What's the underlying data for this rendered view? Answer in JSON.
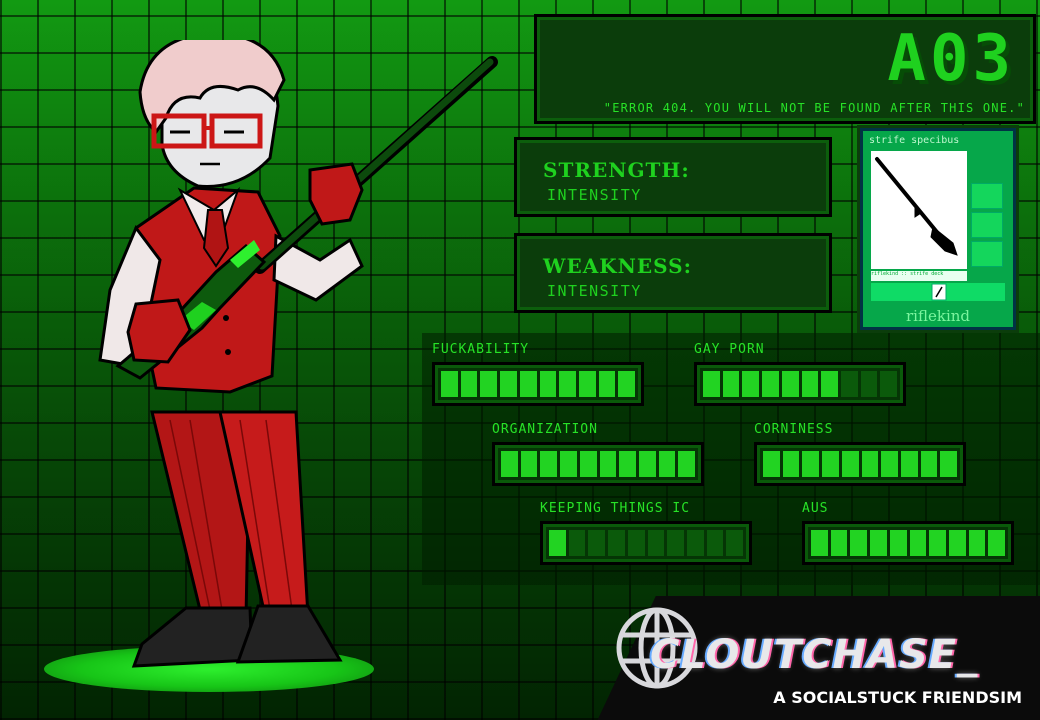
{
  "header": {
    "code": "A03",
    "quote": "\"ERROR 404. YOU WILL NOT BE FOUND AFTER THIS ONE.\""
  },
  "strength": {
    "label": "STRENGTH:",
    "value": "INTENSITY"
  },
  "weakness": {
    "label": "WEAKNESS:",
    "value": "INTENSITY"
  },
  "strife": {
    "label": "strife specibus",
    "kind": "riflekind",
    "card_caption": "riflekind :: strife deck",
    "icon": "rifle-icon"
  },
  "stats": [
    {
      "label": "FUCKABILITY",
      "filled": 10,
      "total": 10
    },
    {
      "label": "GAY PORN",
      "filled": 7,
      "total": 10
    },
    {
      "label": "ORGANIZATION",
      "filled": 10,
      "total": 10
    },
    {
      "label": "CORNINESS",
      "filled": 10,
      "total": 10
    },
    {
      "label": "KEEPING THINGS IC",
      "filled": 1,
      "total": 10
    },
    {
      "label": "AUS",
      "filled": 10,
      "total": 10
    }
  ],
  "logo": {
    "title": "CLOUTCHASE_",
    "subtitle": "A SOCIALSTUCK FRIENDSIM",
    "icon": "globe-icon"
  },
  "colors": {
    "accent": "#1fd11f",
    "panel": "#0b3d0b",
    "suit": "#c01818"
  }
}
